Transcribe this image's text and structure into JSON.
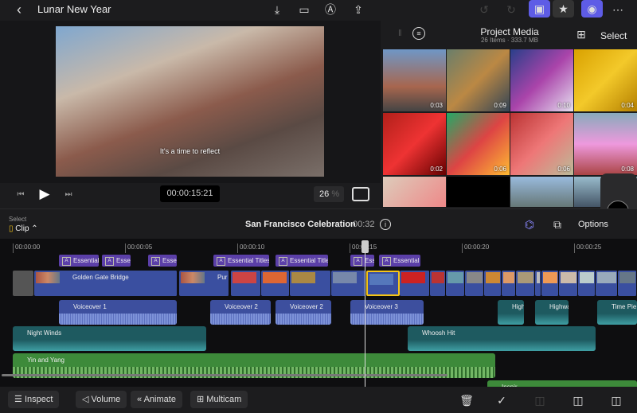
{
  "topbar": {
    "title": "Lunar New Year",
    "icons": [
      "chevron-left-icon",
      "import-icon",
      "camera-icon",
      "pencil-icon",
      "share-icon",
      "undo-icon",
      "redo-icon",
      "photo-library-icon",
      "titles-icon",
      "voiceover-icon",
      "more-icon"
    ]
  },
  "viewer": {
    "subtitle": "It's a time to reflect",
    "timecode": "00:00:15:21",
    "zoom": "26",
    "zoom_unit": "%"
  },
  "media": {
    "title": "Project Media",
    "subtitle": "26 Items · 333.7 MB",
    "select": "Select",
    "thumbs": [
      {
        "dur": "0:03",
        "c": "linear-gradient(180deg,#6f97c6,#a7664e 60%,#444)"
      },
      {
        "dur": "0:09",
        "c": "linear-gradient(135deg,#6a7e6a,#b84 50%,#345)"
      },
      {
        "dur": "0:10",
        "c": "linear-gradient(135deg,#2a3f8a,#a4a 50%,#e5e0f0)"
      },
      {
        "dur": "0:04",
        "c": "linear-gradient(135deg,#d9a100,#f3c92a,#b58000)"
      },
      {
        "dur": "0:02",
        "c": "linear-gradient(135deg,#b2201a,#e33,#600)"
      },
      {
        "dur": "0:06",
        "c": "linear-gradient(135deg,#2a6,#d44 50%,#fb3)"
      },
      {
        "dur": "0:06",
        "c": "linear-gradient(135deg,#b33,#e77,#bb9)"
      },
      {
        "dur": "0:08",
        "c": "linear-gradient(180deg,#8ab,#e9d,#a44)"
      },
      {
        "dur": "",
        "c": "linear-gradient(135deg,#dcb,#e88)"
      },
      {
        "dur": "",
        "c": "#000"
      },
      {
        "dur": "",
        "c": "linear-gradient(180deg,#9bd,#677)"
      },
      {
        "dur": "",
        "c": "linear-gradient(180deg,#9bc,#456)"
      }
    ]
  },
  "timeline": {
    "select_label": "Select",
    "mode": "Clip",
    "project": "San Francisco Celebration",
    "duration": "00:32",
    "options": "Options",
    "ticks": [
      "00:00:00",
      "00:00:05",
      "00:00:10",
      "00:00:15",
      "00:00:20",
      "00:00:25"
    ],
    "titles": [
      "Essential Titles",
      "Essential Titles",
      "Essential Titles",
      "Essential Titles",
      "Essential Titles",
      "Essential Titles",
      "Essential Titles"
    ],
    "clips": [
      "Golden Gate Bridge",
      "Pur"
    ],
    "voiceovers": [
      "Voiceover 1",
      "Voiceover 2",
      "Voiceover 2",
      "Voiceover 3"
    ],
    "sfx": [
      "Night Winds",
      "Whoosh Hit",
      "High",
      "Highway",
      "Time Pie"
    ],
    "music": [
      "Yin and Yang",
      "Inspir"
    ]
  },
  "toolbar": {
    "inspect": "Inspect",
    "volume": "Volume",
    "animate": "Animate",
    "multicam": "Multicam"
  },
  "colors": {
    "accent": "#5e5ce6",
    "selected": "#f5c518"
  }
}
